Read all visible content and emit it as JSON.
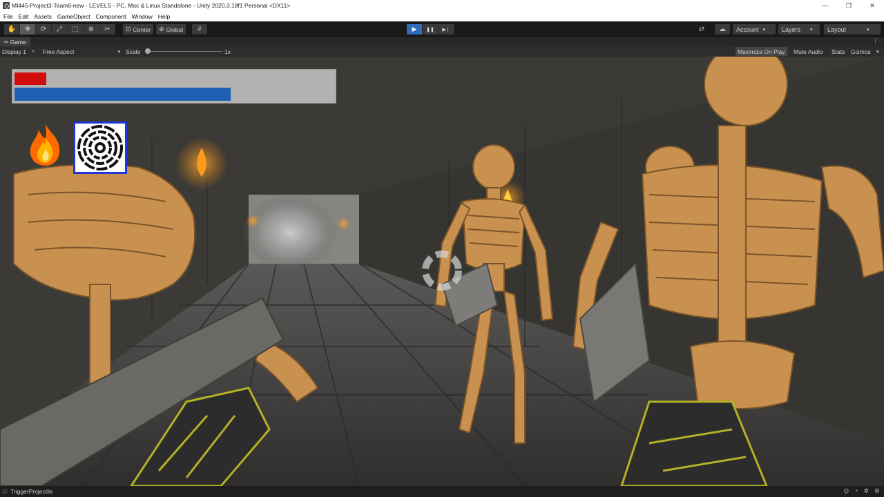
{
  "window": {
    "title": "MI445-Project3-Team6-new - LEVELS - PC, Mac & Linux Standalone - Unity 2020.3.18f1 Personal <DX11>",
    "minimize_glyph": "—",
    "restore_glyph": "❐",
    "close_glyph": "✕"
  },
  "menu": [
    "File",
    "Edit",
    "Assets",
    "GameObject",
    "Component",
    "Window",
    "Help"
  ],
  "toolbar": {
    "tools": [
      {
        "name": "hand-tool-icon",
        "glyph": "✋"
      },
      {
        "name": "move-tool-icon",
        "glyph": "✥"
      },
      {
        "name": "rotate-tool-icon",
        "glyph": "⟳"
      },
      {
        "name": "scale-tool-icon",
        "glyph": "⤢"
      },
      {
        "name": "rect-tool-icon",
        "glyph": "⬚"
      },
      {
        "name": "transform-tool-icon",
        "glyph": "⊕"
      },
      {
        "name": "custom-tool-icon",
        "glyph": "✂"
      }
    ],
    "pivot_label": "Center",
    "space_label": "Global",
    "grid_glyph": "#",
    "play_glyph": "▶",
    "pause_glyph": "❚❚",
    "step_glyph": "▶❘",
    "collab_glyph": "⇄",
    "cloud_glyph": "☁",
    "account_label": "Account",
    "layers_label": "Layers",
    "layout_label": "Layout",
    "caret": "▾"
  },
  "game_tab": {
    "label": "Game",
    "icon_glyph": "∞",
    "menu_glyph": "⋮"
  },
  "game_options": {
    "display": "Display 1",
    "aspect": "Free Aspect",
    "scale_label": "Scale",
    "scale_value": "1x",
    "maximize_on_play": "Maximize On Play",
    "mute_audio": "Mute Audio",
    "stats": "Stats",
    "gizmos": "Gizmos"
  },
  "hud": {
    "health_fraction": 0.1,
    "mana_fraction": 0.68,
    "colors": {
      "health": "#d10d0d",
      "mana": "#1f5fb3",
      "selection": "#1f37d6"
    },
    "abilities": [
      "fire-ability-icon",
      "target-ability-icon"
    ]
  },
  "statusbar": {
    "message": "TriggerProjectile",
    "icon_glyph": "ⓘ"
  }
}
